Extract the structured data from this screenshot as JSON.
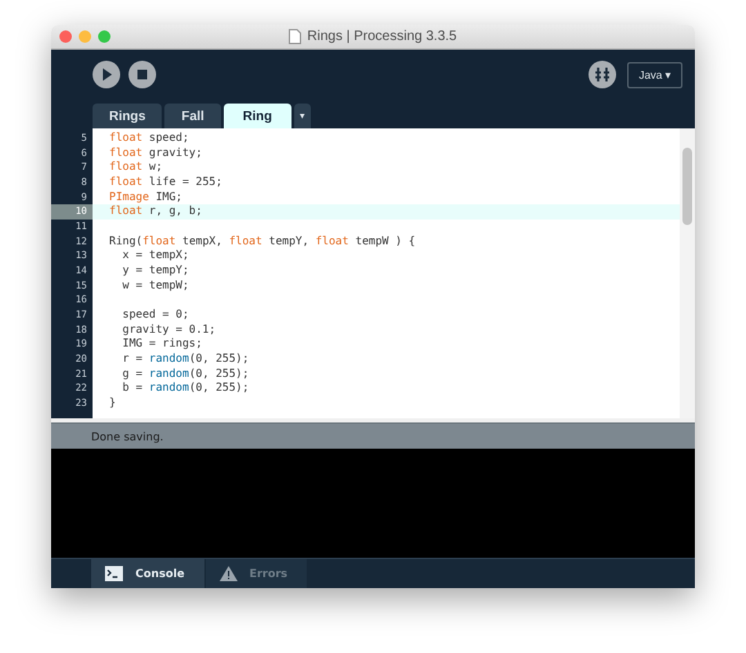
{
  "window": {
    "title": "Rings | Processing 3.3.5"
  },
  "toolbar": {
    "mode": "Java ▾"
  },
  "tabs": [
    {
      "label": "Rings",
      "selected": false
    },
    {
      "label": "Fall",
      "selected": false
    },
    {
      "label": "Ring",
      "selected": true
    }
  ],
  "tab_menu": "▾",
  "editor": {
    "lines": [
      {
        "number": "5",
        "current": false,
        "tokens": [
          {
            "kind": "kw",
            "text": "float"
          },
          {
            "kind": "plain",
            "text": " speed;"
          }
        ]
      },
      {
        "number": "6",
        "current": false,
        "tokens": [
          {
            "kind": "kw",
            "text": "float"
          },
          {
            "kind": "plain",
            "text": " gravity;"
          }
        ]
      },
      {
        "number": "7",
        "current": false,
        "tokens": [
          {
            "kind": "kw",
            "text": "float"
          },
          {
            "kind": "plain",
            "text": " w;"
          }
        ]
      },
      {
        "number": "8",
        "current": false,
        "tokens": [
          {
            "kind": "kw",
            "text": "float"
          },
          {
            "kind": "plain",
            "text": " life = 255;"
          }
        ]
      },
      {
        "number": "9",
        "current": false,
        "tokens": [
          {
            "kind": "kw",
            "text": "PImage"
          },
          {
            "kind": "plain",
            "text": " IMG;"
          }
        ]
      },
      {
        "number": "10",
        "current": true,
        "tokens": [
          {
            "kind": "kw",
            "text": "float"
          },
          {
            "kind": "plain",
            "text": " r, g, b;"
          }
        ]
      },
      {
        "number": "11",
        "current": false
      },
      {
        "number": "12",
        "current": false,
        "tokens": [
          {
            "kind": "plain",
            "text": "Ring("
          },
          {
            "kind": "kw",
            "text": "float"
          },
          {
            "kind": "plain",
            "text": " tempX, "
          },
          {
            "kind": "kw",
            "text": "float"
          },
          {
            "kind": "plain",
            "text": " tempY, "
          },
          {
            "kind": "kw",
            "text": "float"
          },
          {
            "kind": "plain",
            "text": " tempW ) {"
          }
        ]
      },
      {
        "number": "13",
        "current": false,
        "tokens": [
          {
            "kind": "plain",
            "text": "  x = tempX;"
          }
        ]
      },
      {
        "number": "14",
        "current": false,
        "tokens": [
          {
            "kind": "plain",
            "text": "  y = tempY;"
          }
        ]
      },
      {
        "number": "15",
        "current": false,
        "tokens": [
          {
            "kind": "plain",
            "text": "  w = tempW;"
          }
        ]
      },
      {
        "number": "16",
        "current": false
      },
      {
        "number": "17",
        "current": false,
        "tokens": [
          {
            "kind": "plain",
            "text": "  speed = 0;"
          }
        ]
      },
      {
        "number": "18",
        "current": false,
        "tokens": [
          {
            "kind": "plain",
            "text": "  gravity = 0.1;"
          }
        ]
      },
      {
        "number": "19",
        "current": false,
        "tokens": [
          {
            "kind": "plain",
            "text": "  IMG = rings;"
          }
        ]
      },
      {
        "number": "20",
        "current": false,
        "tokens": [
          {
            "kind": "plain",
            "text": "  r = "
          },
          {
            "kind": "fn",
            "text": "random"
          },
          {
            "kind": "plain",
            "text": "(0, 255);"
          }
        ]
      },
      {
        "number": "21",
        "current": false,
        "tokens": [
          {
            "kind": "plain",
            "text": "  g = "
          },
          {
            "kind": "fn",
            "text": "random"
          },
          {
            "kind": "plain",
            "text": "(0, 255);"
          }
        ]
      },
      {
        "number": "22",
        "current": false,
        "tokens": [
          {
            "kind": "plain",
            "text": "  b = "
          },
          {
            "kind": "fn",
            "text": "random"
          },
          {
            "kind": "plain",
            "text": "(0, 255);"
          }
        ]
      },
      {
        "number": "23",
        "current": false,
        "tokens": [
          {
            "kind": "plain",
            "text": "}"
          }
        ]
      }
    ]
  },
  "status": "Done saving.",
  "console_tabs": [
    {
      "kind": "console",
      "label": "Console",
      "selected": true
    },
    {
      "kind": "errors",
      "label": "Errors",
      "selected": false
    }
  ]
}
